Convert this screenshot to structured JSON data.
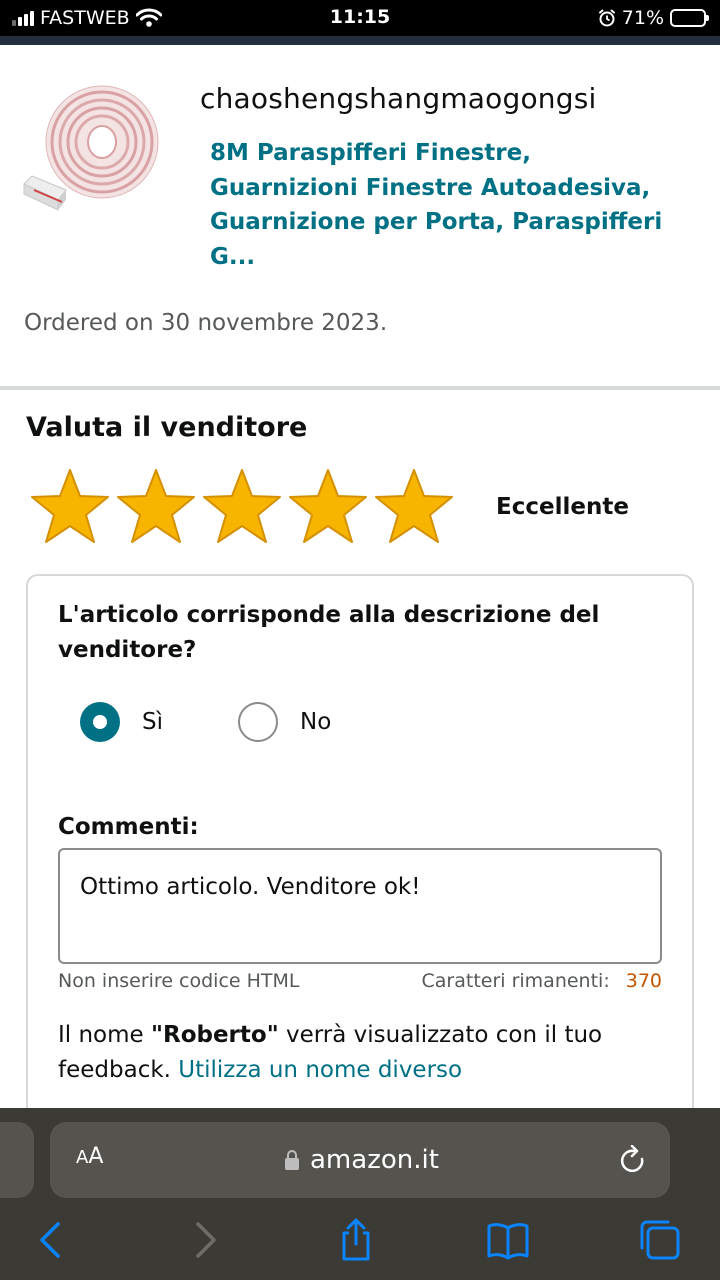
{
  "status_bar": {
    "carrier": "FASTWEB",
    "time": "11:15",
    "battery": "71%",
    "battery_level": 0.71
  },
  "product": {
    "seller": "chaoshengshangmaogongsi",
    "title": "8M Paraspifferi Finestre, Guarnizioni Finestre Autoadesiva, Guarnizione per Porta, Paraspifferi G...",
    "order_date": "Ordered on 30 novembre 2023.",
    "image_icon": "weatherstrip-roll-image"
  },
  "rating": {
    "heading": "Valuta il venditore",
    "stars": 5,
    "max": 5,
    "label": "Eccellente",
    "star_color": "#f7b500"
  },
  "feedback": {
    "question": "L'articolo corrisponde alla descrizione del venditore?",
    "options": [
      {
        "label": "Sì",
        "selected": true
      },
      {
        "label": "No",
        "selected": false
      }
    ],
    "comments_label": "Commenti:",
    "comment_value": "Ottimo articolo. Venditore ok!",
    "hint": "Non inserire codice HTML",
    "remaining_label": "Caratteri rimanenti:",
    "remaining_count": "370",
    "name_prefix": "Il nome ",
    "name": "\"Roberto\"",
    "name_suffix": " verrà visualizzato con il tuo feedback. ",
    "change_name_link": "Utilizza un nome diverso"
  },
  "browser": {
    "aa_big": "A",
    "aa_small": "A",
    "url": "amazon.it",
    "accent": "#007aff"
  },
  "colors": {
    "link": "#007185",
    "selected_radio": "#007185",
    "count": "#c45500"
  }
}
